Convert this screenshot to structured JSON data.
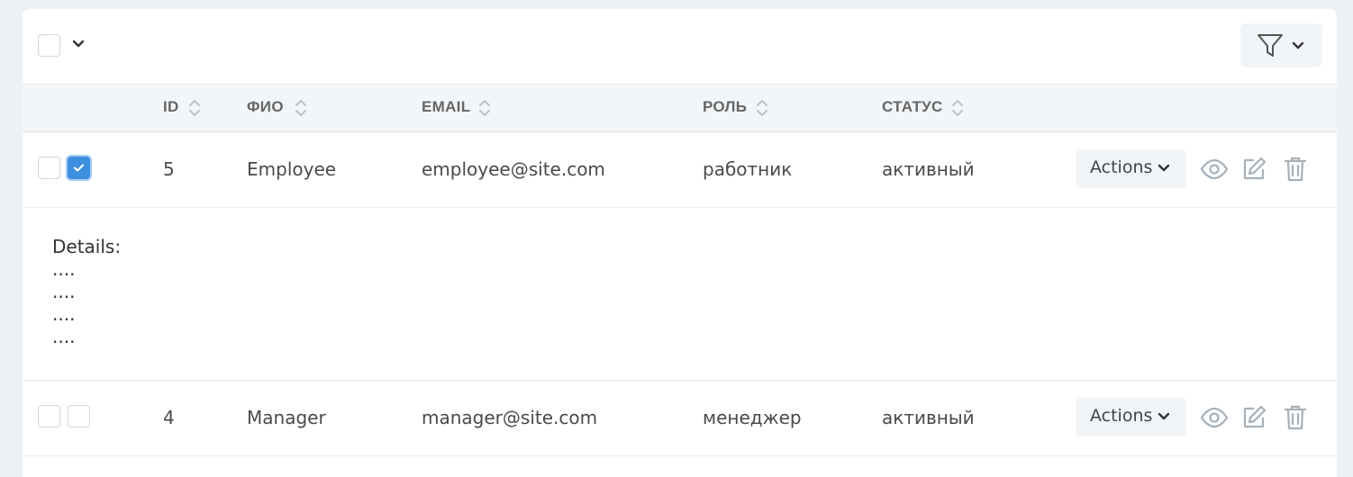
{
  "toolbar": {
    "select_all_checked": false
  },
  "columns": [
    {
      "key": "id",
      "label": "ID"
    },
    {
      "key": "fio",
      "label": "ФИО"
    },
    {
      "key": "email",
      "label": "EMAIL"
    },
    {
      "key": "role",
      "label": "РОЛЬ"
    },
    {
      "key": "status",
      "label": "СТАТУС"
    }
  ],
  "rows": [
    {
      "id": "5",
      "fio": "Employee",
      "email": "employee@site.com",
      "role": "работник",
      "status": "активный",
      "expanded": true,
      "selected": true,
      "actions_label": "Actions"
    },
    {
      "id": "4",
      "fio": "Manager",
      "email": "manager@site.com",
      "role": "менеджер",
      "status": "активный",
      "expanded": false,
      "selected": false,
      "actions_label": "Actions"
    }
  ],
  "details": {
    "title": "Details:",
    "lines": [
      "....",
      "....",
      "....",
      "...."
    ]
  },
  "icons": {
    "view": "eye-icon",
    "edit": "edit-icon",
    "delete": "trash-icon",
    "filter": "filter-icon",
    "sort": "sort-icon"
  },
  "colors": {
    "accent": "#3d8fe0",
    "header_bg": "#f3f6f9",
    "page_bg": "#eef1f4"
  }
}
